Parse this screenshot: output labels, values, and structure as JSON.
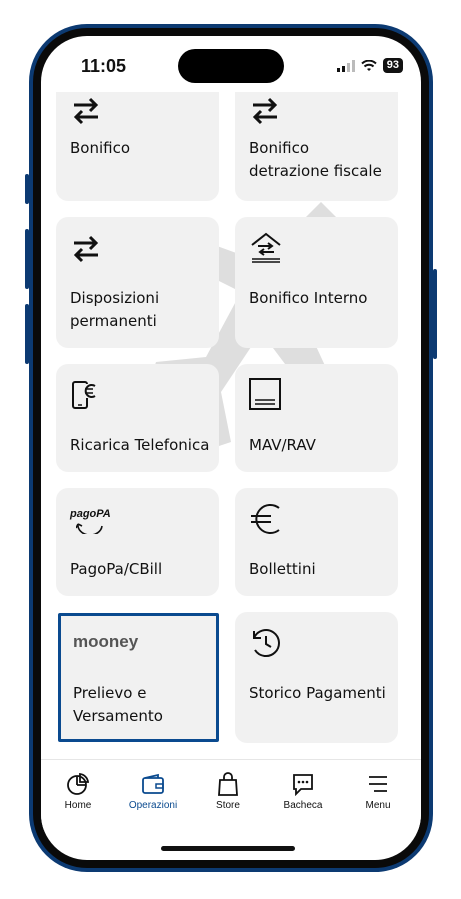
{
  "status": {
    "time": "11:05",
    "battery": "93"
  },
  "tiles": [
    {
      "label": "Bonifico",
      "icon": "transfer-arrows-icon"
    },
    {
      "label": "Bonifico detrazione fiscale",
      "icon": "transfer-arrows-icon"
    },
    {
      "label": "Disposizioni permanenti",
      "icon": "transfer-arrows-icon"
    },
    {
      "label": "Bonifico Interno",
      "icon": "internal-transfer-icon"
    },
    {
      "label": "Ricarica Telefonica",
      "icon": "phone-euro-icon"
    },
    {
      "label": "MAV/RAV",
      "icon": "document-box-icon"
    },
    {
      "label": "PagoPa/CBill",
      "icon": "pagopa-logo-icon",
      "logo_text": "pagoPA"
    },
    {
      "label": "Bollettini",
      "icon": "euro-icon"
    },
    {
      "label": "Prelievo e Versamento",
      "icon": "mooney-logo",
      "logo_text": "mooney",
      "selected": true
    },
    {
      "label": "Storico Pagamenti",
      "icon": "history-clock-icon"
    }
  ],
  "tabbar": [
    {
      "label": "Home",
      "icon": "pie-chart-icon"
    },
    {
      "label": "Operazioni",
      "icon": "wallet-icon",
      "active": true
    },
    {
      "label": "Store",
      "icon": "shopping-bag-icon"
    },
    {
      "label": "Bacheca",
      "icon": "chat-bubble-icon"
    },
    {
      "label": "Menu",
      "icon": "hamburger-menu-icon"
    }
  ],
  "colors": {
    "accent": "#0a4a8f",
    "tile_bg": "#f1f1f1",
    "frame": "#0c3a72"
  }
}
